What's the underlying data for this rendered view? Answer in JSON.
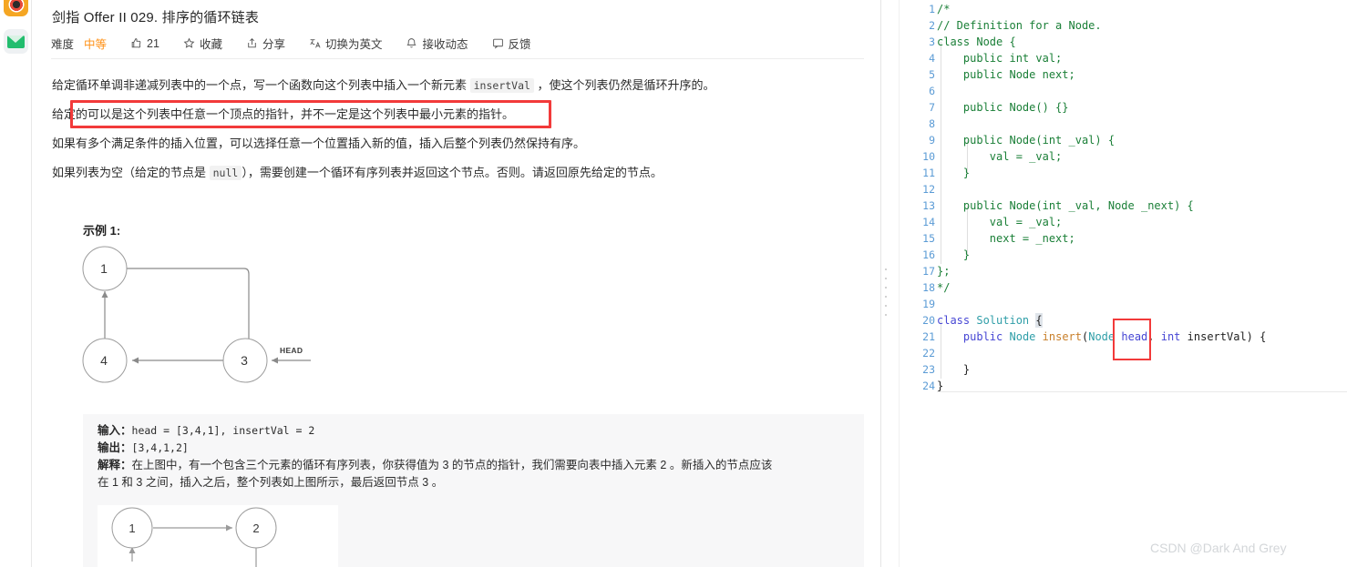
{
  "rail": {
    "icons": [
      {
        "name": "browser-icon",
        "label": ""
      },
      {
        "name": "mail-icon",
        "label": ""
      }
    ]
  },
  "problem": {
    "title": "剑指 Offer II 029. 排序的循环链表",
    "meta": {
      "difficulty_label": "难度",
      "difficulty_value": "中等",
      "like_count": "21",
      "favorite_label": "收藏",
      "share_label": "分享",
      "translate_label": "切换为英文",
      "subscribe_label": "接收动态",
      "feedback_label": "反馈"
    },
    "paragraphs": {
      "p1_before": "给定循环单调非递减列表中的一个点，写一个函数向这个列表中插入一个新元素 ",
      "p1_code": "insertVal",
      "p1_after": " ，使这个列表仍然是循环升序的。",
      "p2": "给定的可以是这个列表中任意一个顶点的指针，并不一定是这个列表中最小元素的指针。",
      "p3": "如果有多个满足条件的插入位置，可以选择任意一个位置插入新的值，插入后整个列表仍然保持有序。",
      "p4_before": "如果列表为空（给定的节点是 ",
      "p4_code": "null",
      "p4_after": "），需要创建一个循环有序列表并返回这个节点。否则。请返回原先给定的节点。"
    },
    "example_title": "示例 1:",
    "diagram1": {
      "nodes": [
        {
          "label": "1"
        },
        {
          "label": "3"
        },
        {
          "label": "4"
        }
      ],
      "head_label": "HEAD"
    },
    "example_block": {
      "input_label": "输入：",
      "input_value": "head = [3,4,1], insertVal = 2",
      "output_label": "输出：",
      "output_value": "[3,4,1,2]",
      "explain_label": "解释：",
      "explain_line1": "在上图中，有一个包含三个元素的循环有序列表，你获得值为 3 的节点的指针，我们需要向表中插入元素 2 。新插入的节点应该",
      "explain_line2": "在 1 和 3 之间，插入之后，整个列表如上图所示，最后返回节点 3 。"
    },
    "diagram2": {
      "nodes": [
        {
          "label": "1"
        },
        {
          "label": "2"
        }
      ]
    }
  },
  "editor": {
    "line_numbers": [
      "1",
      "2",
      "3",
      "4",
      "5",
      "6",
      "7",
      "8",
      "9",
      "10",
      "11",
      "12",
      "13",
      "14",
      "15",
      "16",
      "17",
      "18",
      "19",
      "20",
      "21",
      "22",
      "23",
      "24"
    ],
    "lines": [
      {
        "n": 1,
        "text": "/*"
      },
      {
        "n": 2,
        "text": "// Definition for a Node."
      },
      {
        "n": 3,
        "text": "class Node {"
      },
      {
        "n": 4,
        "text": "    public int val;"
      },
      {
        "n": 5,
        "text": "    public Node next;"
      },
      {
        "n": 6,
        "text": ""
      },
      {
        "n": 7,
        "text": "    public Node() {}"
      },
      {
        "n": 8,
        "text": ""
      },
      {
        "n": 9,
        "text": "    public Node(int _val) {"
      },
      {
        "n": 10,
        "text": "        val = _val;"
      },
      {
        "n": 11,
        "text": "    }"
      },
      {
        "n": 12,
        "text": ""
      },
      {
        "n": 13,
        "text": "    public Node(int _val, Node _next) {"
      },
      {
        "n": 14,
        "text": "        val = _val;"
      },
      {
        "n": 15,
        "text": "        next = _next;"
      },
      {
        "n": 16,
        "text": "    }"
      },
      {
        "n": 17,
        "text": "};"
      },
      {
        "n": 18,
        "text": "*/"
      },
      {
        "n": 19,
        "text": ""
      },
      {
        "n": 20,
        "text": "class Solution {"
      },
      {
        "n": 21,
        "text": "    public Node insert(Node head, int insertVal) {"
      },
      {
        "n": 22,
        "text": ""
      },
      {
        "n": 23,
        "text": "    }"
      },
      {
        "n": 24,
        "text": "}"
      }
    ],
    "highlight_token": "head,"
  },
  "watermark": "CSDN @Dark And Grey",
  "colors": {
    "accent_orange": "#ff9014",
    "annotation_red": "#f23a3a",
    "comment_green": "#1a7f37",
    "keyword_blue": "#4646d4",
    "type_teal": "#2f9ea8",
    "method_orange": "#c87f2a",
    "linenum_blue": "#5b9bd5",
    "example_bg": "#f7f7f8"
  }
}
